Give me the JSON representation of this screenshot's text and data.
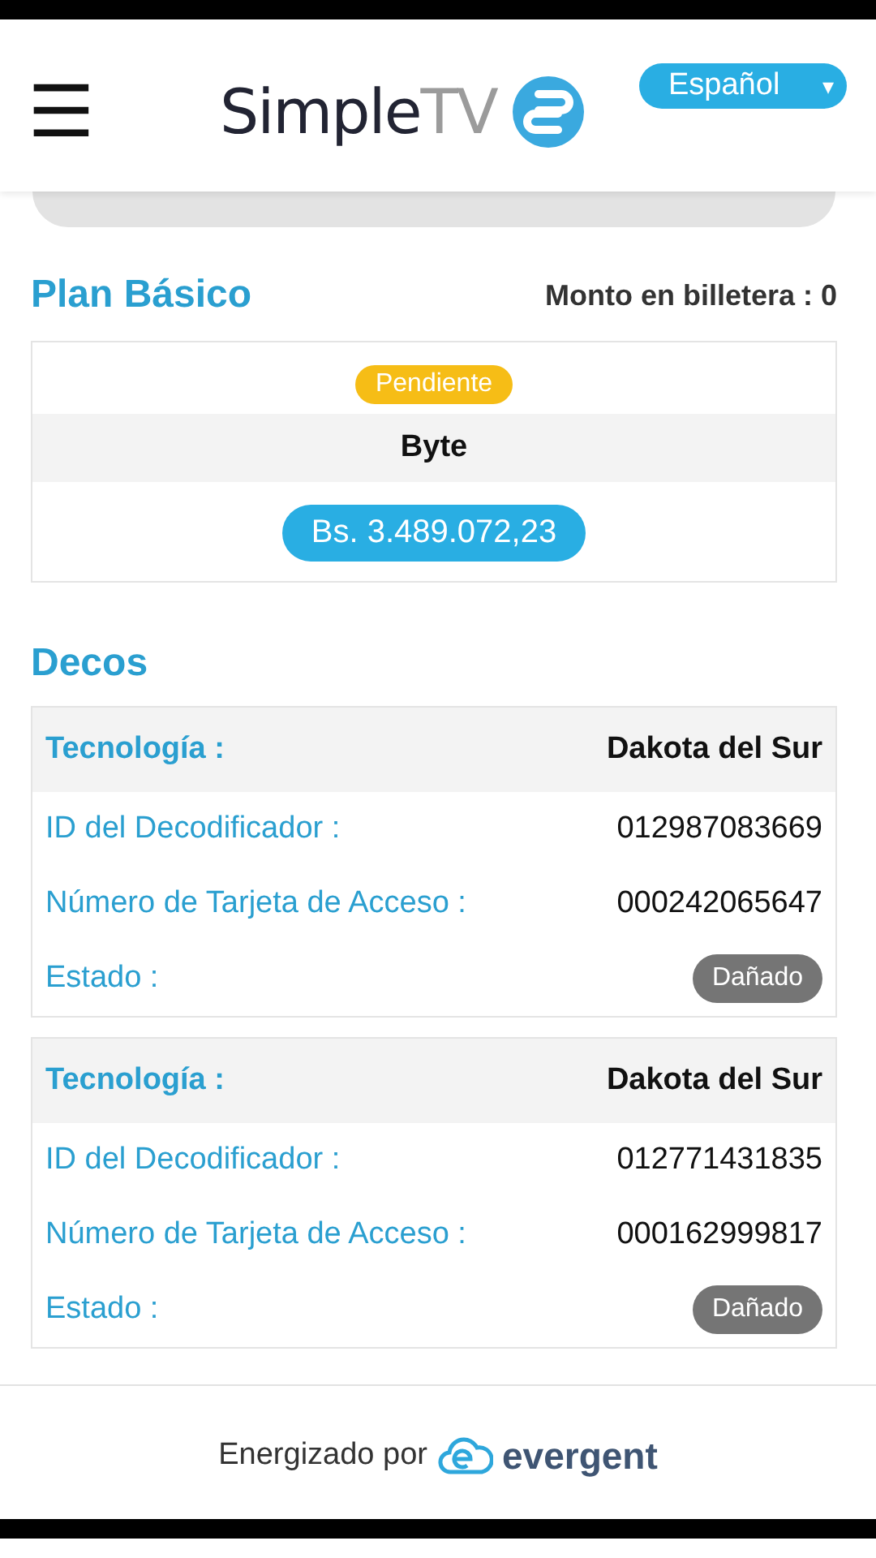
{
  "header": {
    "menu_icon": "☰",
    "logo": {
      "main": "Simple",
      "accent": "TV"
    },
    "language": {
      "value": "Español",
      "caret": "▾"
    }
  },
  "plan": {
    "title": "Plan Básico",
    "wallet": "Monto en billetera : 0",
    "status": "Pendiente",
    "name": "Byte",
    "price": "Bs. 3.489.072,23"
  },
  "decos": {
    "title": "Decos",
    "cards": [
      {
        "rows": [
          {
            "kind": "header",
            "label": "Tecnología :",
            "value": "Dakota del Sur"
          },
          {
            "kind": "text",
            "label": "ID del Decodificador :",
            "value": "012987083669"
          },
          {
            "kind": "text",
            "label": "Número de Tarjeta de Acceso :",
            "value": "000242065647"
          },
          {
            "kind": "badge",
            "label": "Estado :",
            "value": "Dañado"
          }
        ]
      },
      {
        "rows": [
          {
            "kind": "header",
            "label": "Tecnología :",
            "value": "Dakota del Sur"
          },
          {
            "kind": "text",
            "label": "ID del Decodificador :",
            "value": "012771431835"
          },
          {
            "kind": "text",
            "label": "Número de Tarjeta de Acceso :",
            "value": "000162999817"
          },
          {
            "kind": "badge",
            "label": "Estado :",
            "value": "Dañado"
          }
        ]
      }
    ]
  },
  "footer": {
    "text": "Energizado por",
    "brand": "evergent"
  }
}
